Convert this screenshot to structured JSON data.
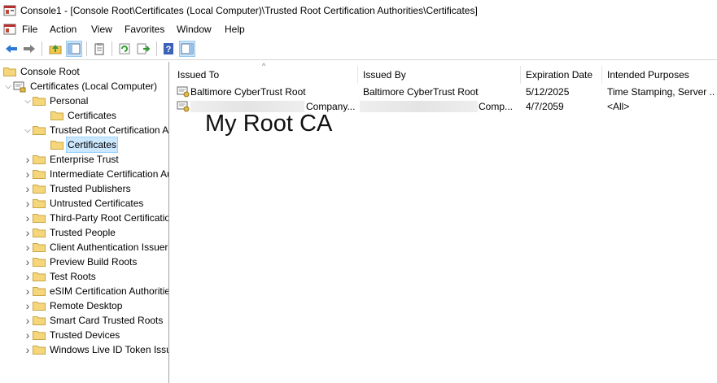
{
  "window": {
    "title": "Console1 - [Console Root\\Certificates (Local Computer)\\Trusted Root Certification Authorities\\Certificates]"
  },
  "menu": {
    "items": [
      "File",
      "Action",
      "View",
      "Favorites",
      "Window",
      "Help"
    ]
  },
  "toolbar": {
    "icons": [
      "back-arrow-icon",
      "forward-arrow-icon",
      "up-folder-icon",
      "show-hide-tree-icon",
      "properties-icon",
      "refresh-icon",
      "export-list-icon",
      "help-icon",
      "action-pane-icon"
    ]
  },
  "tree": {
    "root": "Console Root",
    "computer": "Certificates (Local Computer)",
    "items": [
      {
        "label": "Personal",
        "expanded": true
      },
      {
        "label": "Certificates",
        "child": true
      },
      {
        "label": "Trusted Root Certification Authorities",
        "expanded": true
      },
      {
        "label": "Certificates",
        "child": true,
        "selected": true
      },
      {
        "label": "Enterprise Trust"
      },
      {
        "label": "Intermediate Certification Authorities"
      },
      {
        "label": "Trusted Publishers"
      },
      {
        "label": "Untrusted Certificates"
      },
      {
        "label": "Third-Party Root Certification Authorities"
      },
      {
        "label": "Trusted People"
      },
      {
        "label": "Client Authentication Issuers"
      },
      {
        "label": "Preview Build Roots"
      },
      {
        "label": "Test Roots"
      },
      {
        "label": "eSIM Certification Authorities"
      },
      {
        "label": "Remote Desktop"
      },
      {
        "label": "Smart Card Trusted Roots"
      },
      {
        "label": "Trusted Devices"
      },
      {
        "label": "Windows Live ID Token Issuer"
      }
    ]
  },
  "list": {
    "columns": [
      "Issued To",
      "Issued By",
      "Expiration Date",
      "Intended Purposes"
    ],
    "rows": [
      {
        "issued_to": "Baltimore CyberTrust Root",
        "issued_by": "Baltimore CyberTrust Root",
        "expiration": "5/12/2025",
        "purposes": "Time Stamping, Server ..."
      },
      {
        "issued_to": "Company...",
        "issued_by": "Comp...",
        "expiration": "4/7/2059",
        "purposes": "<All>"
      }
    ]
  },
  "annotation": {
    "text": "My Root CA"
  },
  "colors": {
    "selection": "#cce8ff",
    "folder": "#f5d67a",
    "border": "#a0a0a0"
  }
}
